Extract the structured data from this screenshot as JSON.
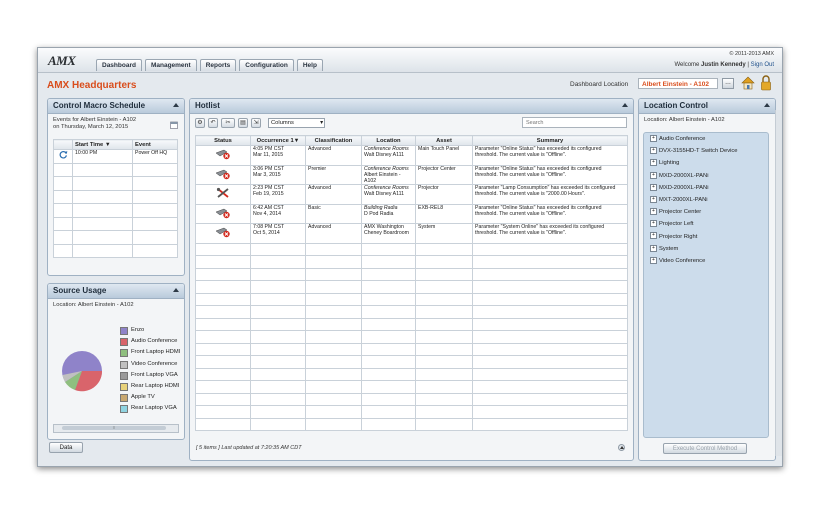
{
  "app": {
    "logo": "AMX",
    "title": "AMX Headquarters",
    "copyright": "© 2011-2013 AMX",
    "welcome_prefix": "Welcome",
    "user": "Justin Kennedy",
    "sign_out": "Sign Out",
    "tabs": [
      "Dashboard",
      "Management",
      "Reports",
      "Configuration",
      "Help"
    ],
    "dashboard_location_label": "Dashboard Location",
    "dashboard_location_value": "Albert Einstein - A102",
    "accent": "#d94d1c"
  },
  "macro": {
    "title": "Control Macro Schedule",
    "events_line1": "Events for Albert Einstein - A102",
    "events_line2": "on Thursday, March 12, 2015",
    "col_start": "Start Time",
    "col_event": "Event",
    "rows": [
      {
        "time": "10:00 PM",
        "event": "Power Off HQ"
      }
    ]
  },
  "source_usage": {
    "title": "Source Usage",
    "location": "Location:  Albert Einstein - A102",
    "data_button": "Data",
    "legend": [
      {
        "label": "Enzo",
        "color": "#8f83c9"
      },
      {
        "label": "Audio Conference",
        "color": "#d9646b"
      },
      {
        "label": "Front Laptop HDMI",
        "color": "#8fbf7f"
      },
      {
        "label": "Video Conference",
        "color": "#c0c0c0"
      },
      {
        "label": "Front Laptop VGA",
        "color": "#9a9a9a"
      },
      {
        "label": "Rear Laptop HDMI",
        "color": "#e8d27a"
      },
      {
        "label": "Apple TV",
        "color": "#c9a870"
      },
      {
        "label": "Rear Laptop VGA",
        "color": "#8fd3e0"
      }
    ]
  },
  "hotlist": {
    "title": "Hotlist",
    "columns_select": "Columns",
    "search_placeholder": "Search",
    "headers": [
      "Status",
      "Occurrence",
      "Classification",
      "Location",
      "Asset",
      "Summary"
    ],
    "rows": [
      {
        "occ1": "4:05 PM CST",
        "occ2": "Mar 11, 2015",
        "class": "Advanced",
        "loc1": "Conference Rooms",
        "loc2": "Walt Disney A111",
        "loc3": "",
        "asset": "Main Touch Panel",
        "sum": "Parameter \"Online Status\" has exceeded its configured threshold.  The current value is \"Offline\".",
        "icon": "projector-error-icon"
      },
      {
        "occ1": "3:06 PM CST",
        "occ2": "Mar 3, 2015",
        "class": "Premier",
        "loc1": "Conference Rooms",
        "loc2": "Albert Einstein -",
        "loc3": "A102",
        "asset": "Projector Center",
        "sum": "Parameter \"Online Status\" has exceeded its configured threshold.  The current value is \"Offline\".",
        "icon": "projector-error-icon"
      },
      {
        "occ1": "2:23 PM CST",
        "occ2": "Feb 19, 2015",
        "class": "Advanced",
        "loc1": "Conference Rooms",
        "loc2": "Walt Disney A111",
        "loc3": "",
        "asset": "Projector",
        "sum": "Parameter \"Lamp Consumption\" has exceeded its configured threshold.  The current value is \"2000.00 Hours\".",
        "icon": "tools-icon"
      },
      {
        "occ1": "6:42 AM CST",
        "occ2": "Nov 4, 2014",
        "class": "Basic",
        "loc1": "Building Radia",
        "loc2": "D Pod Radia",
        "loc3": "",
        "asset": "EXB-REL8",
        "sum": "Parameter \"Online Status\" has exceeded its configured threshold.  The current value is \"Offline\".",
        "icon": "projector-error-icon"
      },
      {
        "occ1": "7:08 PM CST",
        "occ2": "Oct 5, 2014",
        "class": "Advanced",
        "loc1": "AMX Washington",
        "loc2": "Cheney Boardroom",
        "loc3": "",
        "asset": "System",
        "sum": "Parameter \"System Online\" has exceeded its configured threshold.  The current value is \"Offline\".",
        "icon": "projector-error-icon"
      }
    ],
    "footer": "[ 5 items ]  Last updated at 7:20:35 AM CDT"
  },
  "location_control": {
    "title": "Location Control",
    "location": "Location:  Albert Einstein - A102",
    "items": [
      "Audio Conference",
      "DVX-3155HD-T  Switch Device",
      "Lighting",
      "MXD-2000XL-PANi",
      "MXD-2000XL-PANi",
      "MXT-2000XL-PANi",
      "Projector Center",
      "Projector Left",
      "Projector Right",
      "System",
      "Video Conference"
    ],
    "execute_button": "Execute Control Method"
  }
}
